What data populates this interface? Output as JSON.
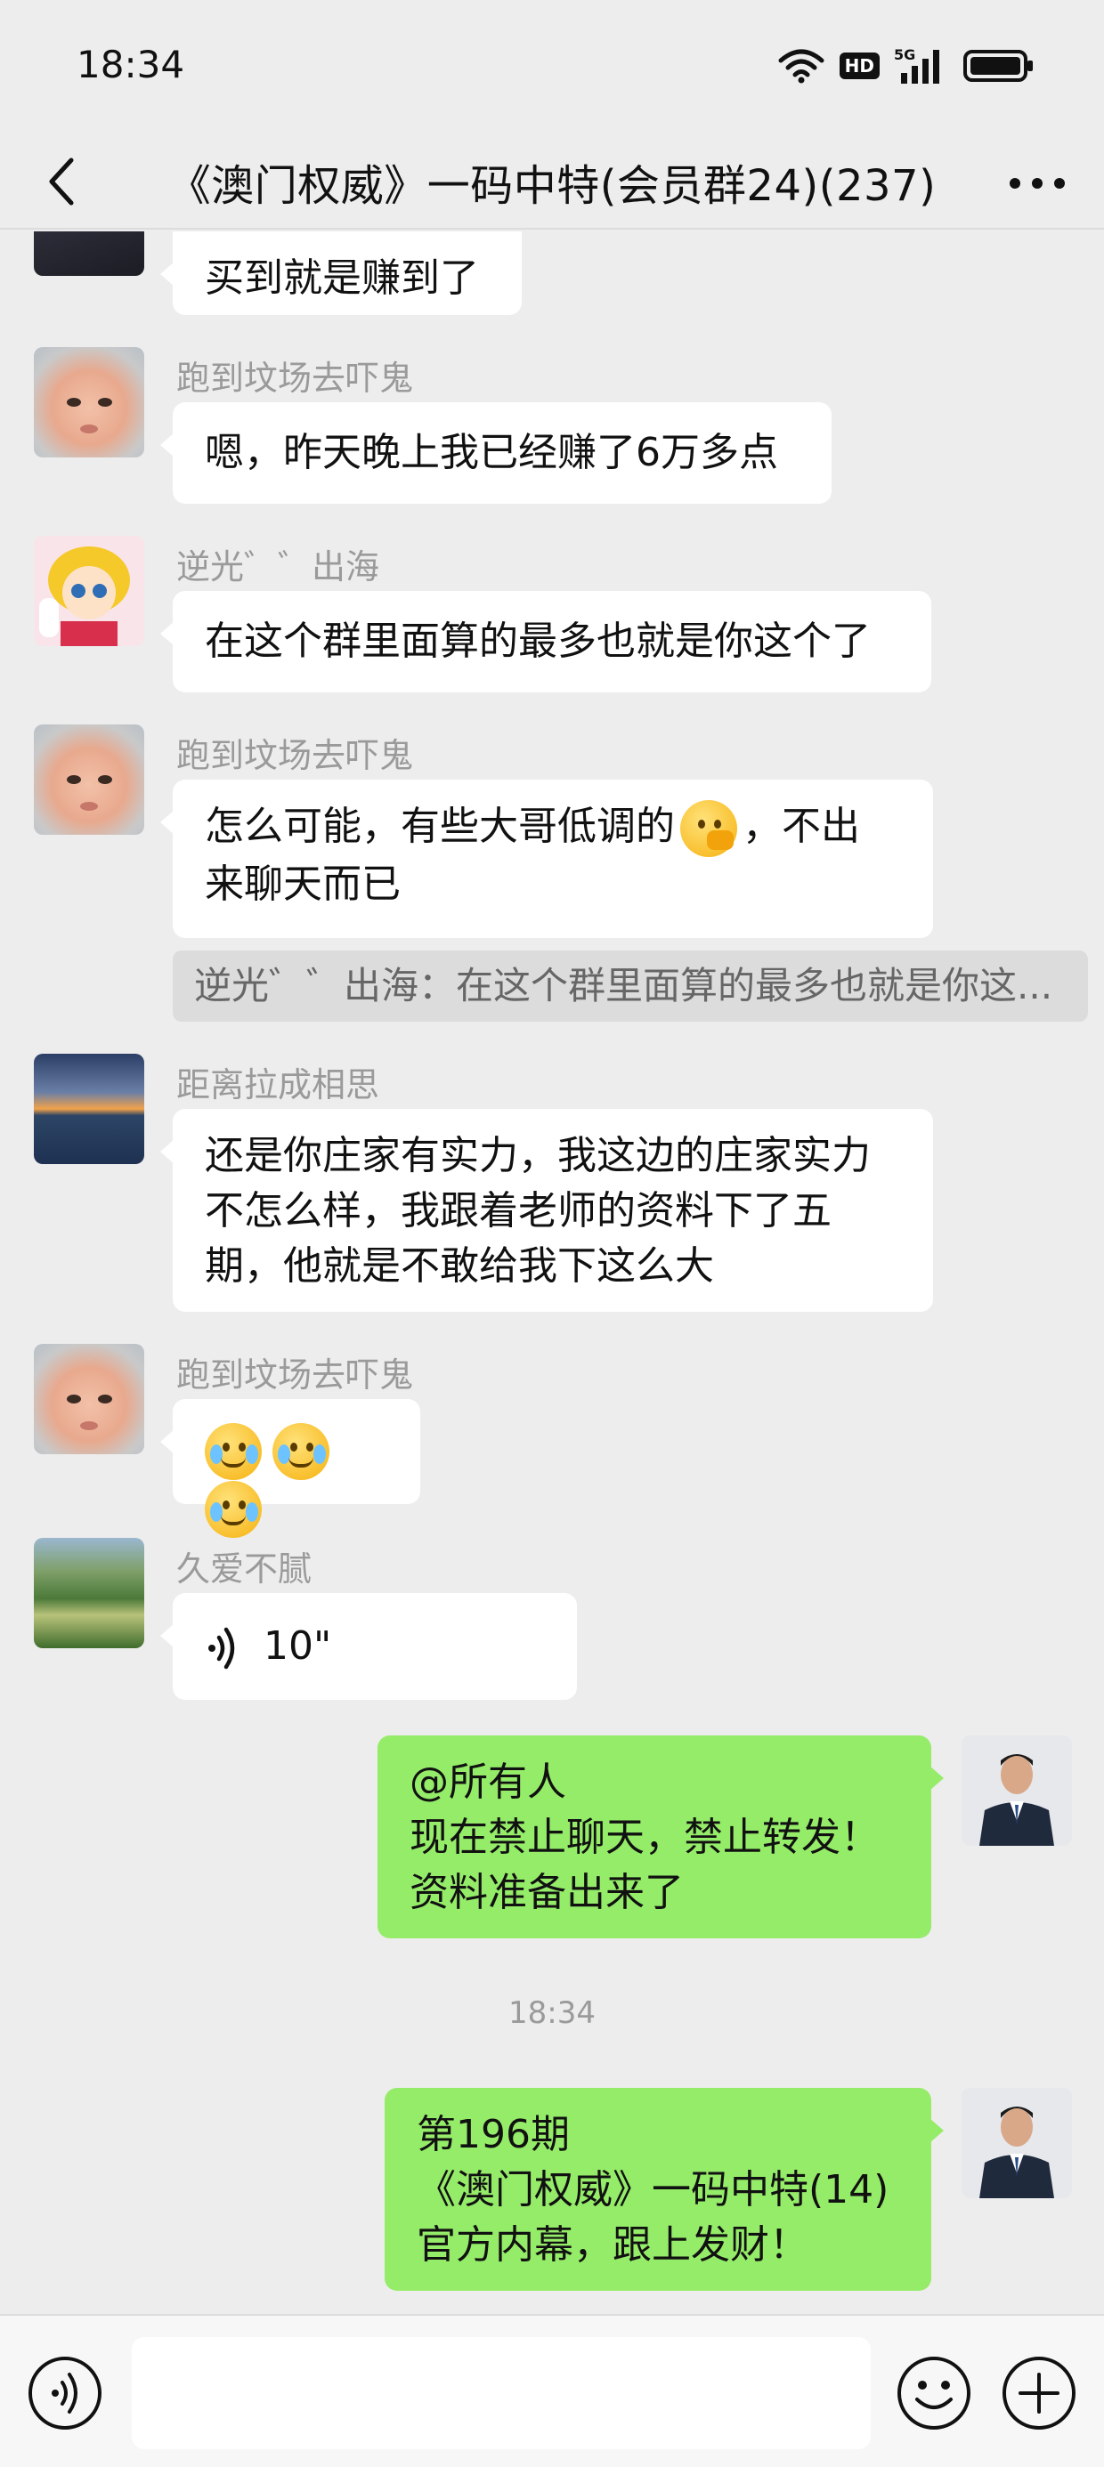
{
  "status_bar": {
    "time": "18:34",
    "hd": "HD",
    "network": "5G"
  },
  "nav": {
    "title": "《澳门权威》一码中特(会员群24)(237)"
  },
  "messages": [
    {
      "type": "text",
      "side": "left",
      "sender": "",
      "text": "买到就是赚到了"
    },
    {
      "type": "text",
      "side": "left",
      "sender": "跑到坟场去吓鬼",
      "text": "嗯，昨天晚上我已经赚了6万多点"
    },
    {
      "type": "text",
      "side": "left",
      "sender": "逆光゛゛出海",
      "text": "在这个群里面算的最多也就是你这个了"
    },
    {
      "type": "text",
      "side": "left",
      "sender": "跑到坟场去吓鬼",
      "text_a": "怎么可能，有些大哥低调的",
      "text_b": "，不出",
      "text_c": "来聊天而已",
      "emoji": "thinking-face"
    },
    {
      "type": "quote",
      "text": "逆光゛゛出海：在这个群里面算的最多也就是你这..."
    },
    {
      "type": "text",
      "side": "left",
      "sender": "距离拉成相思",
      "lines": [
        "还是你庄家有实力，我这边的庄家实力",
        "不怎么样，我跟着老师的资料下了五",
        "期，他就是不敢给我下这么大"
      ]
    },
    {
      "type": "emoji",
      "side": "left",
      "sender": "跑到坟场去吓鬼",
      "emojis": [
        "face-crying",
        "face-crying",
        "face-crying"
      ]
    },
    {
      "type": "voice",
      "side": "left",
      "sender": "久爱不腻",
      "duration": "10\""
    },
    {
      "type": "text",
      "side": "right",
      "lines": [
        "@所有人",
        "现在禁止聊天，禁止转发！",
        "资料准备出来了"
      ]
    },
    {
      "type": "time",
      "text": "18:34"
    },
    {
      "type": "text",
      "side": "right",
      "lines": [
        "第196期",
        "《澳门权威》一码中特(14)",
        "官方内幕，跟上发财！"
      ]
    }
  ],
  "colors": {
    "background": "#ededed",
    "bubble_self": "#95ec69",
    "bubble_other": "#ffffff",
    "meta_text": "#9a9a9a"
  },
  "icons": [
    "back-arrow-icon",
    "more-dots-icon",
    "wifi-icon",
    "signal-icon",
    "battery-icon",
    "voice-mode-icon",
    "emoji-icon",
    "plus-icon",
    "voice-wave-icon"
  ]
}
